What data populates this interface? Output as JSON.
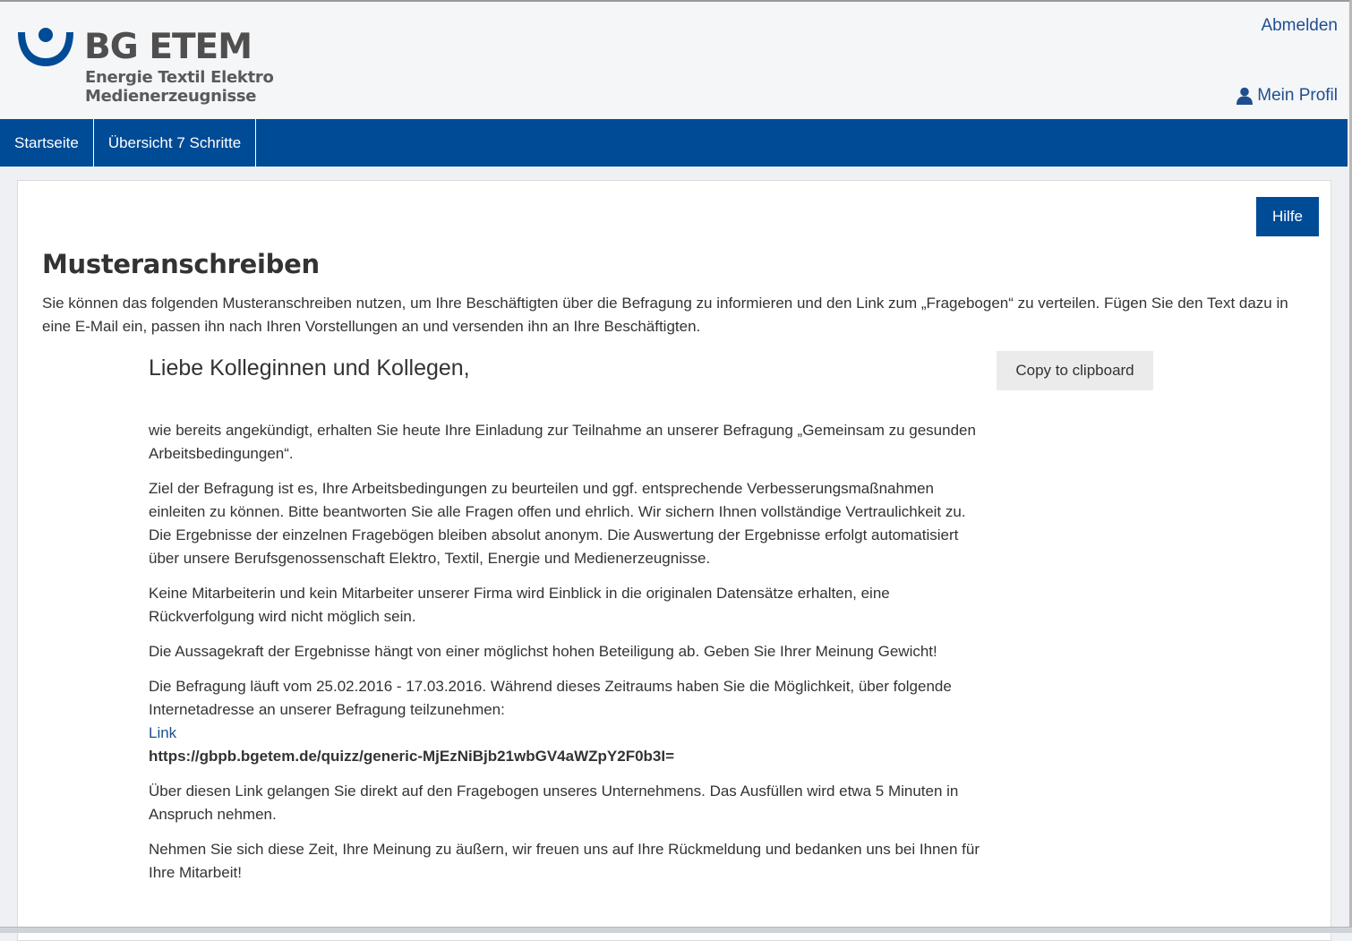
{
  "header": {
    "logo": {
      "title": "BG ETEM",
      "subtitle_line1": "Energie Textil Elektro",
      "subtitle_line2": "Medienerzeugnisse",
      "brand_color": "#004b96"
    },
    "logout_label": "Abmelden",
    "profile_label": "Mein Profil",
    "profile_icon": "user-icon"
  },
  "nav": {
    "items": [
      {
        "label": "Startseite"
      },
      {
        "label": "Übersicht 7 Schritte"
      }
    ],
    "bar_color": "#004b96"
  },
  "main": {
    "help_label": "Hilfe",
    "title": "Musteranschreiben",
    "intro": "Sie können das folgenden Musteranschreiben nutzen, um Ihre Beschäftigten über die Befragung zu informieren und den Link zum „Fragebogen“ zu verteilen. Fügen Sie den Text dazu in eine E-Mail ein, passen ihn nach Ihren Vorstellungen an und versenden ihn an Ihre Beschäftigten.",
    "copy_label": "Copy to clipboard",
    "letter": {
      "greeting": "Liebe Kolleginnen und Kollegen,",
      "p1": "wie bereits angekündigt, erhalten Sie heute Ihre Einladung zur Teilnahme an unserer Befragung „Gemeinsam zu gesunden Arbeitsbedingungen“.",
      "p2": "Ziel der Befragung ist es, Ihre Arbeitsbedingungen zu beurteilen und ggf. entsprechende Verbesserungsmaßnahmen einleiten zu können. Bitte beantworten Sie alle Fragen offen und ehrlich. Wir sichern Ihnen vollständige Vertraulichkeit zu. Die Ergebnisse der einzelnen Fragebögen bleiben absolut anonym. Die Auswertung der Ergebnisse erfolgt automatisiert über unsere Berufsgenossenschaft Elektro, Textil, Energie und Medienerzeugnisse.",
      "p3": "Keine Mitarbeiterin und kein Mitarbeiter unserer Firma wird Einblick in die originalen Datensätze erhalten, eine Rückverfolgung wird nicht möglich sein.",
      "p4": "Die Aussagekraft der Ergebnisse hängt von einer möglichst hohen Beteiligung ab. Geben Sie Ihrer Meinung Gewicht!",
      "p5": "Die Befragung läuft vom 25.02.2016 - 17.03.2016. Während dieses Zeitraums haben Sie die Möglichkeit, über folgende Internetadresse an unserer Befragung teilzunehmen:",
      "link_label": "Link",
      "url": "https://gbpb.bgetem.de/quizz/generic-MjEzNiBjb21wbGV4aWZpY2F0b3I=",
      "p6": "Über diesen Link gelangen Sie direkt auf den Fragebogen unseres Unternehmens. Das Ausfüllen wird etwa 5 Minuten in Anspruch nehmen.",
      "p7": "Nehmen Sie sich diese Zeit, Ihre Meinung zu äußern, wir freuen uns auf Ihre Rückmeldung und bedanken uns bei Ihnen für Ihre Mitarbeit!"
    }
  }
}
